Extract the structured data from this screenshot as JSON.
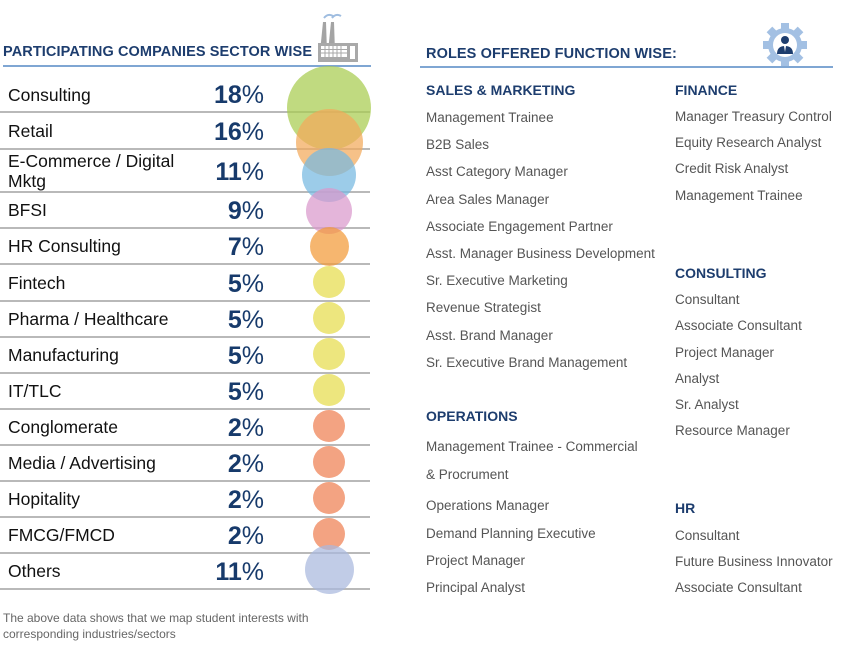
{
  "left": {
    "title": "PARTICIPATING COMPANIES SECTOR WISE",
    "icon": "factory-icon",
    "sectors": [
      {
        "name": "Consulting",
        "value": "18",
        "color": "#a7cc4f"
      },
      {
        "name": "Retail",
        "value": "16",
        "color": "#f2a95a"
      },
      {
        "name": "E-Commerce / Digital\nMktg",
        "value": "11",
        "color": "#76b9e0"
      },
      {
        "name": "BFSI",
        "value": "9",
        "color": "#d999cc"
      },
      {
        "name": "HR Consulting",
        "value": "7",
        "color": "#f29a37"
      },
      {
        "name": "Fintech",
        "value": "5",
        "color": "#e6dc4c"
      },
      {
        "name": "Pharma / Healthcare",
        "value": "5",
        "color": "#e6dc4c"
      },
      {
        "name": "Manufacturing",
        "value": "5",
        "color": "#e6dc4c"
      },
      {
        "name": "IT/TLC",
        "value": "5",
        "color": "#e6dc4c"
      },
      {
        "name": "Conglomerate",
        "value": "2",
        "color": "#ee7f52"
      },
      {
        "name": "Media / Advertising",
        "value": "2",
        "color": "#ee7f52"
      },
      {
        "name": "Hopitality",
        "value": "2",
        "color": "#ee7f52"
      },
      {
        "name": "FMCG/FMCD",
        "value": "2",
        "color": "#ee7f52"
      },
      {
        "name": "Others",
        "value": "11",
        "color": "#a9b8de"
      }
    ],
    "percent_sign": "%",
    "note_line1": "The above data shows that we map student interests with",
    "note_line2": "corresponding industries/sectors"
  },
  "right": {
    "title": "ROLES OFFERED FUNCTION WISE:",
    "icon": "gear-person-icon",
    "groups": [
      {
        "title": "SALES & MARKETING",
        "items": [
          "Management Trainee",
          "B2B Sales",
          "Asst Category Manager",
          "Area Sales Manager",
          "Associate Engagement Partner",
          "Asst. Manager Business Development",
          "Sr. Executive Marketing",
          "Revenue Strategist",
          "Asst. Brand Manager",
          "Sr. Executive Brand Management"
        ]
      },
      {
        "title": "OPERATIONS",
        "items": [
          "Management Trainee - Commercial",
          "& Procrument",
          "Operations Manager",
          "Demand Planning Executive",
          "Project Manager",
          "Principal Analyst"
        ]
      },
      {
        "title": "FINANCE",
        "items": [
          "Manager Treasury Control",
          "Equity Research Analyst",
          "Credit Risk Analyst",
          "Management Trainee"
        ]
      },
      {
        "title": "CONSULTING",
        "items": [
          "Consultant",
          "Associate Consultant",
          "Project Manager",
          "Analyst",
          "Sr. Analyst",
          "Resource Manager"
        ]
      },
      {
        "title": "HR",
        "items": [
          "Consultant",
          "Future Business Innovator",
          "Associate Consultant"
        ]
      }
    ]
  },
  "colors": {
    "heading": "#1d3d6e",
    "rule": "#7fa6d3",
    "icon": "#a9a9a9",
    "gear": "#a3c0e3"
  }
}
